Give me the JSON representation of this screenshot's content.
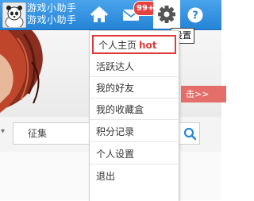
{
  "topbar": {
    "username": "游戏小助手",
    "username_line2": "游戏小助手",
    "notification_count": "99+",
    "gear_tooltip": "设置",
    "icons": [
      "avatar",
      "home-icon",
      "mail-icon",
      "gear-icon",
      "help-icon"
    ],
    "accent_color": "#2584d6"
  },
  "page": {
    "banner_link": "击>>",
    "search_placeholder": "征集"
  },
  "menu": {
    "items": [
      {
        "label": "个人主页",
        "tag": "hot"
      },
      {
        "label": "活跃达人"
      },
      {
        "label": "我的好友"
      },
      {
        "label": "我的收藏盒"
      },
      {
        "label": "积分记录"
      },
      {
        "label": "个人设置"
      },
      {
        "label": "退出"
      }
    ],
    "highlight_color": "#e03b3b"
  }
}
